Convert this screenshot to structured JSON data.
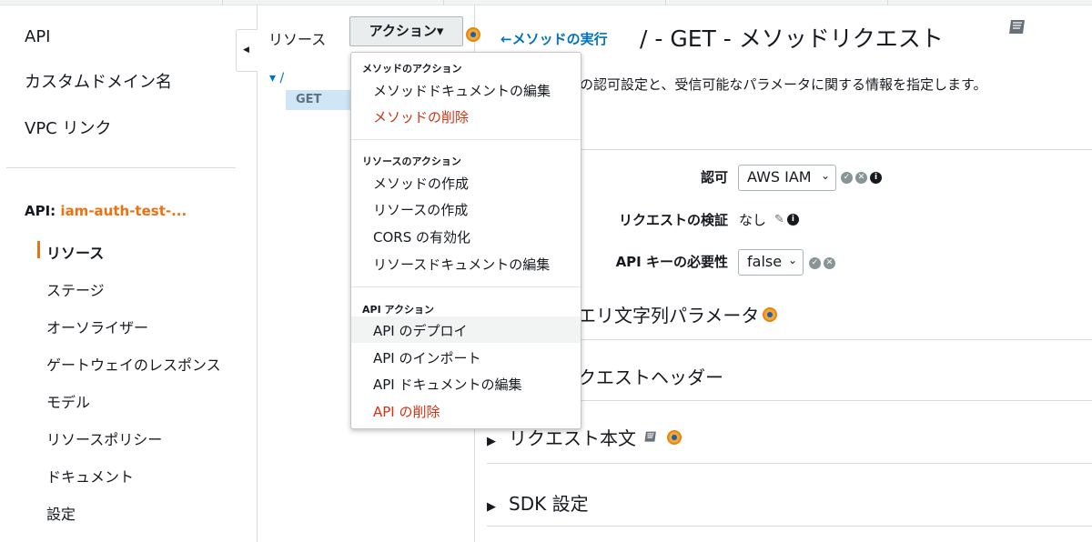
{
  "leftnav": {
    "top_items": [
      "API",
      "カスタムドメイン名",
      "VPC リンク"
    ],
    "api_prefix": "API:",
    "api_name": "iam-auth-test-...",
    "sub_items": [
      "リソース",
      "ステージ",
      "オーソライザー",
      "ゲートウェイのレスポンス",
      "モデル",
      "リソースポリシー",
      "ドキュメント",
      "設定"
    ]
  },
  "resources": {
    "title": "リソース",
    "actions_label": "アクション▾",
    "tree_root": "▾ /",
    "tree_child": "GET"
  },
  "menu": {
    "groups": [
      {
        "title": "メソッドのアクション",
        "items": [
          "メソッドドキュメントの編集",
          "メソッドの削除"
        ]
      },
      {
        "title": "リソースのアクション",
        "items": [
          "メソッドの作成",
          "リソースの作成",
          "CORS の有効化",
          "リソースドキュメントの編集"
        ]
      },
      {
        "title": "API アクション",
        "items": [
          "API のデプロイ",
          "API のインポート",
          "API ドキュメントの編集",
          "API の削除"
        ]
      }
    ]
  },
  "main": {
    "back_link": "メソッドの実行",
    "title": "/ - GET - メソッドリクエスト",
    "description": "の認可設定と、受信可能なパラメータに関する情報を指定します。",
    "auth_label": "認可",
    "auth_value": "AWS IAM",
    "validation_label": "リクエストの検証",
    "validation_value": "なし",
    "apikey_label": "API キーの必要性",
    "apikey_value": "false",
    "sections": [
      "エリ文字列パラメータ",
      "クエストヘッダー",
      "リクエスト本文",
      "SDK 設定"
    ]
  },
  "colors": {
    "accent": "#ec7211",
    "link": "#0073bb",
    "danger": "#d13212"
  },
  "icons": [
    "collapse-left-icon",
    "info-icon",
    "book-icon",
    "check-icon",
    "cancel-icon",
    "pencil-icon",
    "triangle-right-icon",
    "back-arrow-icon"
  ]
}
